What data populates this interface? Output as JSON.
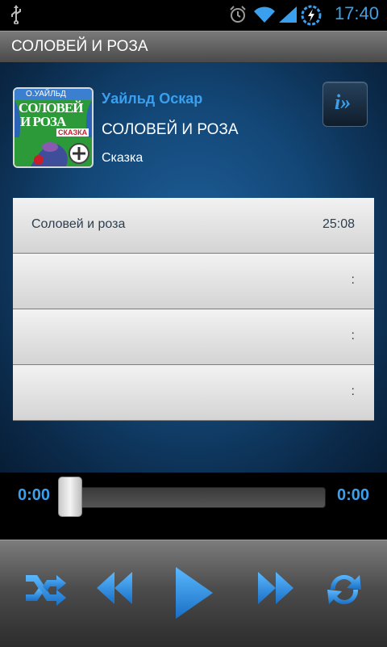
{
  "status_bar": {
    "time": "17:40",
    "icons": [
      "usb-icon",
      "alarm-icon",
      "wifi-icon",
      "signal-icon",
      "battery-charging-icon"
    ]
  },
  "header": {
    "title": "СОЛОВЕЙ И РОЗА"
  },
  "book": {
    "author": "Уайльд Оскар",
    "title": "СОЛОВЕЙ И РОЗА",
    "genre": "Сказка",
    "cover": {
      "author": "О.УАЙЛЬД",
      "title_line1": "СОЛОВЕЙ",
      "title_line2": "И РОЗА",
      "subtitle": "СКАЗКА"
    },
    "info_button": "i»"
  },
  "tracks": [
    {
      "name": "Соловей и роза",
      "duration": "25:08"
    },
    {
      "name": "",
      "duration": ":"
    },
    {
      "name": "",
      "duration": ":"
    },
    {
      "name": "",
      "duration": ":"
    }
  ],
  "player": {
    "elapsed": "0:00",
    "total": "0:00",
    "progress": 0
  },
  "colors": {
    "accent": "#3aa0ee",
    "background": "#134777"
  }
}
